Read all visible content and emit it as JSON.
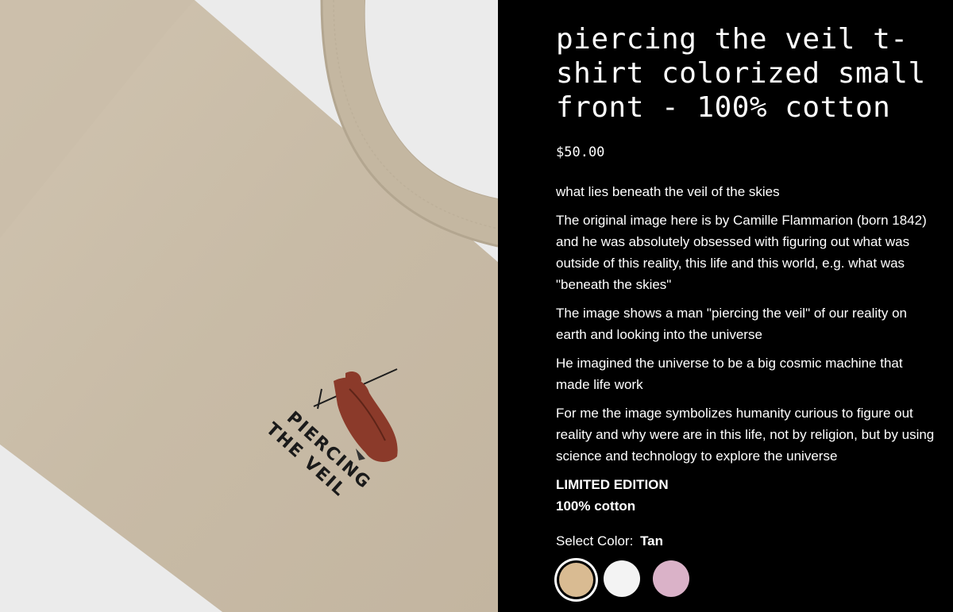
{
  "product": {
    "title": "piercing the veil t-shirt colorized small front - 100% cotton",
    "price": "$50.00",
    "description": [
      "what lies beneath the veil of the skies",
      "The original image here is by Camille Flammarion (born 1842) and he was absolutely obsessed with figuring out what was outside of this reality, this life and this world, e.g. what was \"beneath the skies\"",
      "The image shows a man \"piercing the veil\" of our reality on earth and looking into the universe",
      "He imagined the universe to be a big cosmic machine that made life work",
      "For me the image symbolizes humanity curious to figure out reality and why were are in this life, not by religion, but by using science and technology to explore the universe"
    ],
    "highlights": [
      "LIMITED EDITION",
      "100% cotton"
    ]
  },
  "color_select": {
    "label": "Select Color:",
    "selected": "Tan",
    "options": [
      {
        "name": "Tan",
        "hex": "#d9bb92"
      },
      {
        "name": "White",
        "hex": "#f3f3f3"
      },
      {
        "name": "Pink",
        "hex": "#dab2c8"
      }
    ]
  },
  "print_art": {
    "line1": "PIERCING",
    "line2": "THE VEIL"
  },
  "colors": {
    "shirt": "#cbbea9",
    "background_left": "#ebebeb",
    "background_right": "#000000"
  }
}
